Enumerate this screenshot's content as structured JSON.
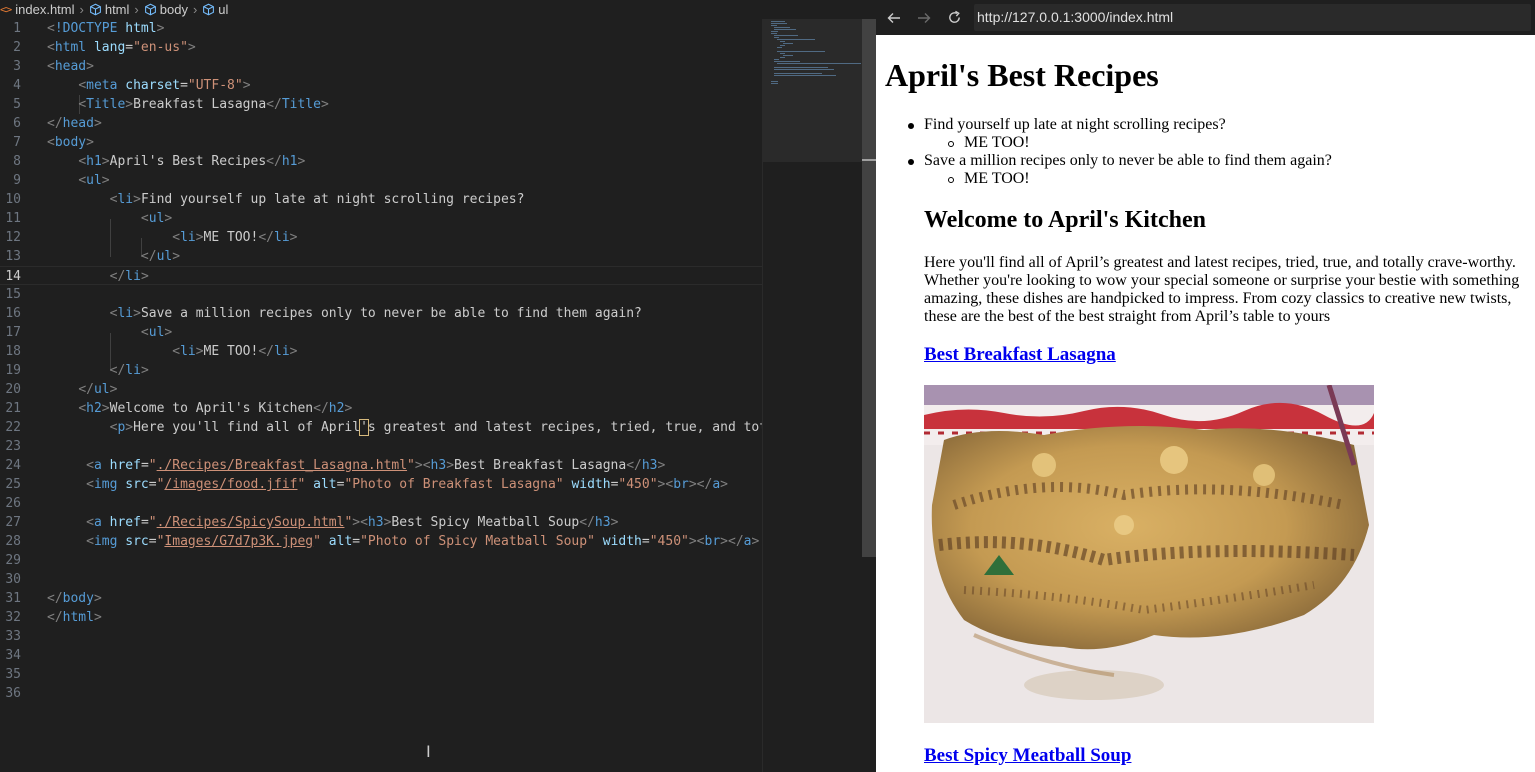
{
  "breadcrumb": {
    "items": [
      "index.html",
      "html",
      "body",
      "ul"
    ]
  },
  "editor": {
    "lines": [
      {
        "n": "1"
      },
      {
        "n": "2"
      },
      {
        "n": "3"
      },
      {
        "n": "4"
      },
      {
        "n": "5"
      },
      {
        "n": "6"
      },
      {
        "n": "7"
      },
      {
        "n": "8"
      },
      {
        "n": "9"
      },
      {
        "n": "10"
      },
      {
        "n": "11"
      },
      {
        "n": "12"
      },
      {
        "n": "13"
      },
      {
        "n": "14"
      },
      {
        "n": "15"
      },
      {
        "n": "16"
      },
      {
        "n": "17"
      },
      {
        "n": "18"
      },
      {
        "n": "19"
      },
      {
        "n": "20"
      },
      {
        "n": "21"
      },
      {
        "n": "22"
      },
      {
        "n": "23"
      },
      {
        "n": "24"
      },
      {
        "n": "25"
      },
      {
        "n": "26"
      },
      {
        "n": "27"
      },
      {
        "n": "28"
      },
      {
        "n": "29"
      },
      {
        "n": "30"
      },
      {
        "n": "31"
      },
      {
        "n": "32"
      },
      {
        "n": "33"
      },
      {
        "n": "34"
      },
      {
        "n": "35"
      },
      {
        "n": "36"
      }
    ],
    "code": {
      "doctype_kw": "!DOCTYPE",
      "doctype_val": "html",
      "html": "html",
      "lang_attr": "lang",
      "lang_val": "\"en-us\"",
      "head": "head",
      "meta": "meta",
      "charset_attr": "charset",
      "charset_val": "\"UTF-8\"",
      "title_tag": "Title",
      "title_text": "Breakfast Lasagna",
      "body": "body",
      "h1": "h1",
      "h1_text": "April's Best Recipes",
      "ul": "ul",
      "li": "li",
      "li1_text": "Find yourself up late at night scrolling recipes?",
      "me_too": "ME TOO!",
      "li2_text": "Save a million recipes only to never be able to find them again?",
      "h2": "h2",
      "h2_text": "Welcome to April's Kitchen",
      "p": "p",
      "p_text_a": "Here you'll find all of April",
      "p_text_b": "'",
      "p_text_c": "s greatest and latest recipes, tried, true, and tota",
      "a": "a",
      "href": "href",
      "href1": "./Recipes/Breakfast_Lasagna.html",
      "h3": "h3",
      "h3_1": "Best Breakfast Lasagna",
      "img": "img",
      "src": "src",
      "src1": "/images/food.jfif",
      "alt": "alt",
      "alt1": "\"Photo of Breakfast Lasagna\"",
      "width": "width",
      "width_val": "\"450\"",
      "br": "br",
      "href2": "./Recipes/SpicySoup.html",
      "h3_2": "Best Spicy Meatball Soup",
      "src2": "Images/G7d7p3K.jpeg",
      "alt2": "\"Photo of Spicy Meatball Soup\""
    }
  },
  "browser": {
    "back_icon": "arrow-left-icon",
    "forward_icon": "arrow-right-icon",
    "reload_icon": "reload-icon",
    "url": "http://127.0.0.1:3000/index.html"
  },
  "page": {
    "title": "April's Best Recipes",
    "list": [
      {
        "text": "Find yourself up late at night scrolling recipes?",
        "sub": "ME TOO!"
      },
      {
        "text": "Save a million recipes only to never be able to find them again?",
        "sub": "ME TOO!"
      }
    ],
    "welcome": "Welcome to April's Kitchen",
    "intro": "Here you'll find all of April’s greatest and latest recipes, tried, true, and totally crave-worthy. Whether you're looking to wow your special someone or surprise your bestie with something amazing, these dishes are handpicked to impress. From cozy classics to creative new twists, these are the best of the best straight from April’s table to yours",
    "link1": "Best Breakfast Lasagna",
    "link2": "Best Spicy Meatball Soup",
    "photo_alt": "Photo of Breakfast Lasagna"
  },
  "colors": {
    "editor_bg": "#1f1f1f",
    "tag": "#569cd6",
    "attribute": "#9cdcfe",
    "string": "#ce9178",
    "link": "#0000ee"
  }
}
